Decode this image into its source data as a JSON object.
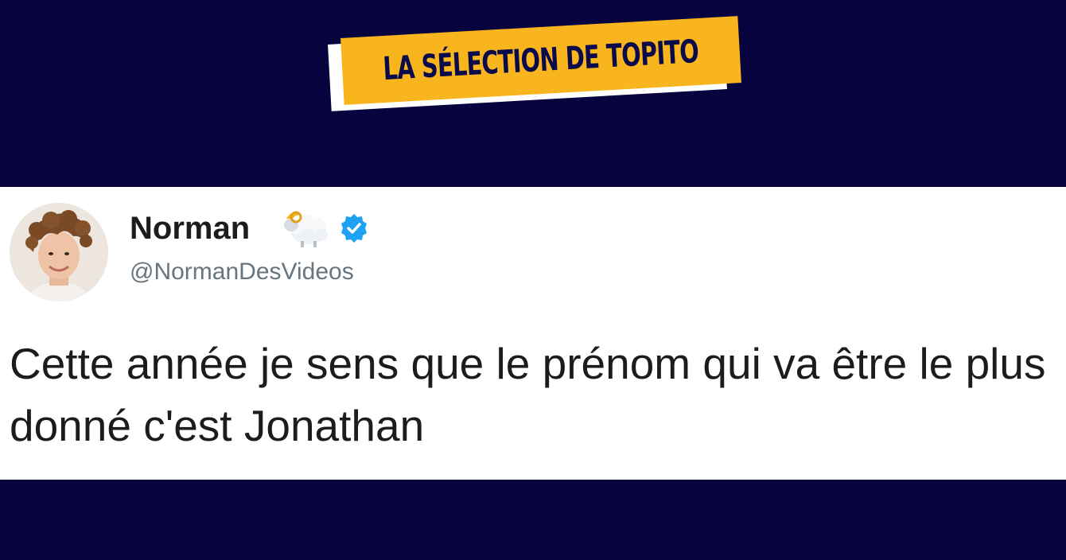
{
  "banner": {
    "label": "LA SÉLECTION DE TOPITO"
  },
  "tweet": {
    "display_name": "Norman",
    "handle": "@NormanDesVideos",
    "emoji_icon": "ram-icon",
    "verified_icon": "verified-badge-icon",
    "text": "Cette année je sens que le prénom qui va être le plus donné c'est Jonathan"
  },
  "colors": {
    "background": "#07033f",
    "banner_yellow": "#f8b51e",
    "banner_text": "#0b0a4a",
    "verified_blue": "#1da1f2",
    "handle_gray": "#66757f"
  }
}
